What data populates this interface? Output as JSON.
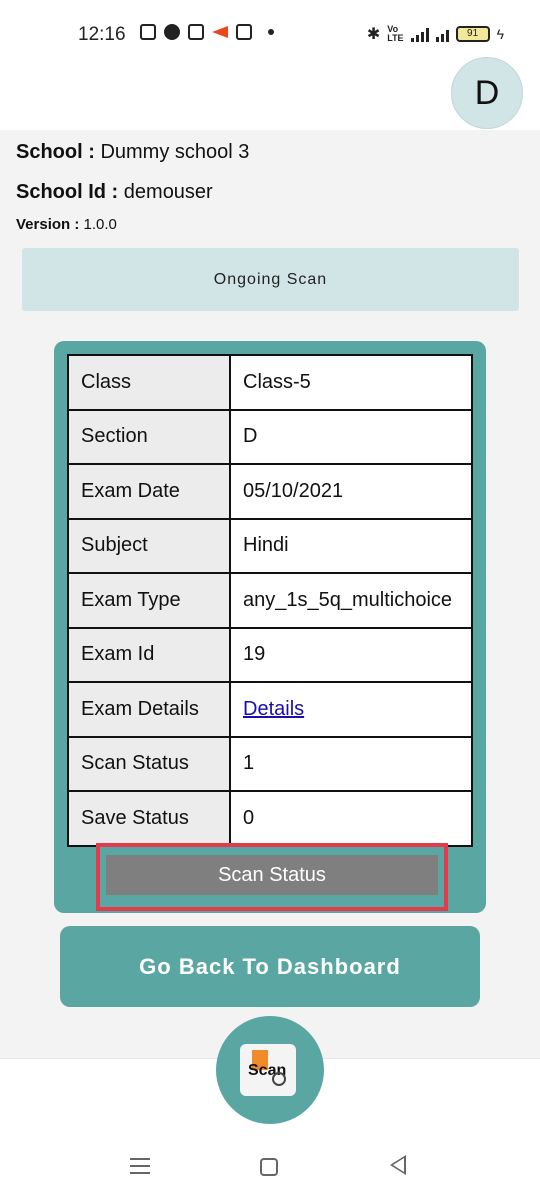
{
  "status_bar": {
    "time": "12:16",
    "battery": "91"
  },
  "avatar": {
    "initial": "D"
  },
  "school": {
    "school_label": "School : ",
    "school_value": "Dummy school 3",
    "id_label": "School Id : ",
    "id_value": "demouser",
    "version_label": "Version : ",
    "version_value": "1.0.0"
  },
  "ongoing_scan_label": "Ongoing Scan",
  "details": {
    "rows": [
      {
        "key": "Class",
        "value": "Class-5"
      },
      {
        "key": "Section",
        "value": "D"
      },
      {
        "key": "Exam Date",
        "value": "05/10/2021"
      },
      {
        "key": "Subject",
        "value": "Hindi"
      },
      {
        "key": "Exam Type",
        "value": "any_1s_5q_multichoice"
      },
      {
        "key": "Exam Id",
        "value": "19"
      },
      {
        "key": "Exam Details",
        "value": "Details"
      },
      {
        "key": "Scan Status",
        "value": "1"
      },
      {
        "key": "Save Status",
        "value": "0"
      }
    ]
  },
  "scan_status_button": "Scan Status",
  "dashboard_button": "Go Back To Dashboard",
  "fab": {
    "label": "Scan",
    "icon": "scan-icon"
  },
  "colors": {
    "teal": "#59a6a3",
    "light_teal": "#d2e5e6",
    "highlight": "#e23b4b"
  }
}
